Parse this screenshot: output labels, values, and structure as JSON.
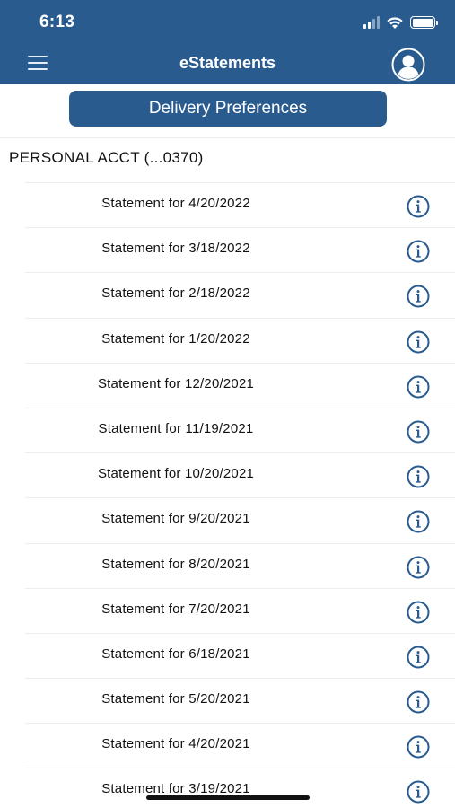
{
  "status_bar": {
    "time": "6:13"
  },
  "header": {
    "title": "eStatements"
  },
  "delivery_preferences_label": "Delivery Preferences",
  "account": {
    "label": "PERSONAL ACCT  (...0370)"
  },
  "statements": [
    {
      "label": "Statement for 4/20/2022"
    },
    {
      "label": "Statement for 3/18/2022"
    },
    {
      "label": "Statement for 2/18/2022"
    },
    {
      "label": "Statement for 1/20/2022"
    },
    {
      "label": "Statement for 12/20/2021"
    },
    {
      "label": "Statement for 11/19/2021"
    },
    {
      "label": "Statement for 10/20/2021"
    },
    {
      "label": "Statement for 9/20/2021"
    },
    {
      "label": "Statement for 8/20/2021"
    },
    {
      "label": "Statement for 7/20/2021"
    },
    {
      "label": "Statement for 6/18/2021"
    },
    {
      "label": "Statement for 5/20/2021"
    },
    {
      "label": "Statement for 4/20/2021"
    },
    {
      "label": "Statement for 3/19/2021"
    }
  ],
  "colors": {
    "brand": "#2a5b8e",
    "info_icon": "#2a5b8e"
  },
  "icons": {
    "menu": "hamburger-menu-icon",
    "profile": "user-profile-icon",
    "info": "info-icon"
  }
}
